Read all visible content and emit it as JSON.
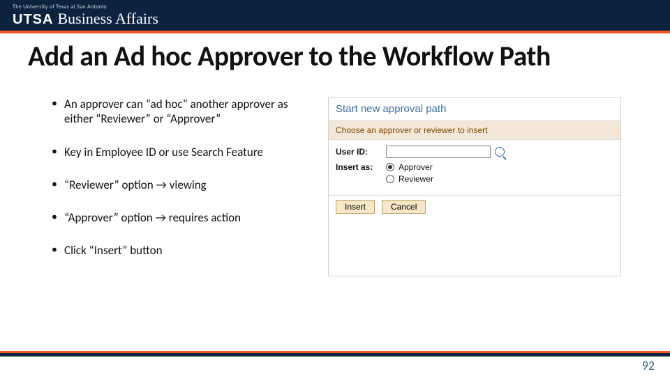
{
  "header": {
    "institution": "The University of Texas at San Antonio",
    "logo": "UTSA",
    "department": "Business Affairs"
  },
  "title": "Add an Ad hoc Approver to the Workflow Path",
  "bullets": [
    "An approver can “ad hoc” another approver as either “Reviewer” or “Approver”",
    "Key in Employee ID or use Search Feature",
    "“Reviewer” option → viewing",
    "“Approver” option → requires action",
    "Click “Insert” button"
  ],
  "panel": {
    "heading": "Start new approval path",
    "subheading": "Choose an approver or reviewer to insert",
    "user_id_label": "User ID:",
    "insert_as_label": "Insert as:",
    "option_approver": "Approver",
    "option_reviewer": "Reviewer",
    "insert_btn": "Insert",
    "cancel_btn": "Cancel"
  },
  "page_number": "92"
}
